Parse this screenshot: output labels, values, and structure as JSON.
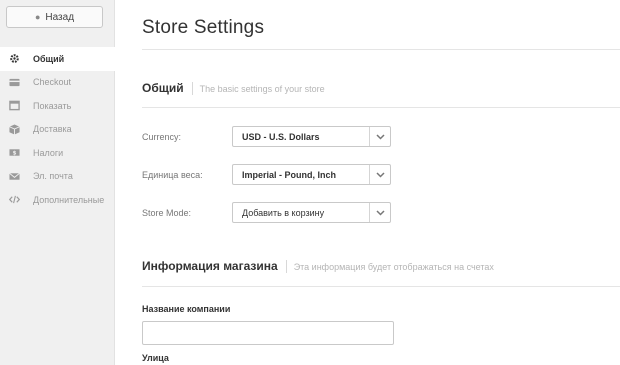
{
  "sidebar": {
    "back_label": "Назад",
    "items": [
      {
        "label": "Общий",
        "icon": "gear-icon",
        "active": true
      },
      {
        "label": "Checkout",
        "icon": "credit-card-icon",
        "active": false
      },
      {
        "label": "Показать",
        "icon": "window-icon",
        "active": false
      },
      {
        "label": "Доставка",
        "icon": "box-icon",
        "active": false
      },
      {
        "label": "Налоги",
        "icon": "dollar-bill-icon",
        "active": false
      },
      {
        "label": "Эл. почта",
        "icon": "envelope-icon",
        "active": false
      },
      {
        "label": "Дополнительные",
        "icon": "code-icon",
        "active": false
      }
    ]
  },
  "main": {
    "title": "Store Settings",
    "general": {
      "title": "Общий",
      "subtitle": "The basic settings of your store",
      "fields": [
        {
          "label": "Currency:",
          "value": "USD - U.S. Dollars"
        },
        {
          "label": "Единица веса:",
          "value": "Imperial - Pound, Inch"
        },
        {
          "label": "Store Mode:",
          "value": "Добавить в корзину"
        }
      ]
    },
    "store_info": {
      "title": "Информация магазина",
      "subtitle": "Эта информация будет отображаться на счетах",
      "company_label": "Название компании",
      "company_value": "",
      "street_label": "Улица"
    }
  },
  "colors": {
    "sidebar_bg": "#f0f0f0",
    "muted_text": "#9a9a9a",
    "border": "#c9c9c9"
  }
}
